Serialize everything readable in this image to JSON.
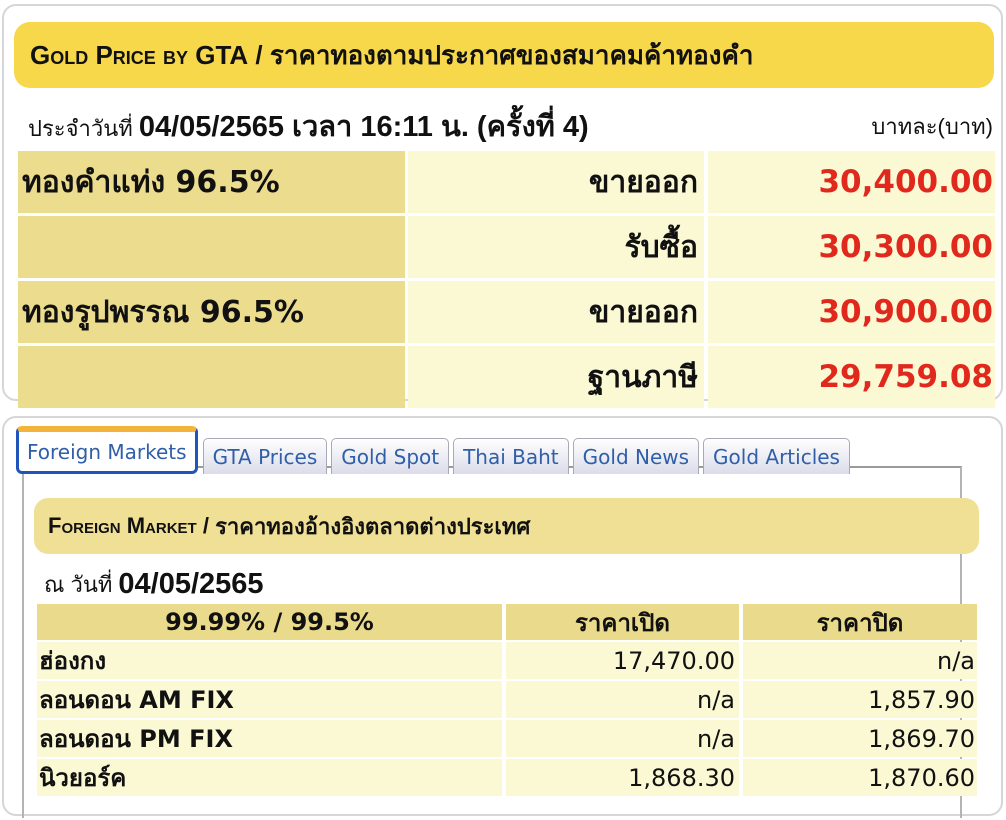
{
  "gta": {
    "header_en": "Gold Price by GTA",
    "header_sep": " / ",
    "header_th": "ราคาทองตามประกาศของสมาคมค้าทองคำ",
    "date_prefix": "ประจำวันที่ ",
    "date_value": "04/05/2565 เวลา 16:11 น. (ครั้งที่ 4)",
    "unit": "บาทละ(บาท)",
    "rows": [
      {
        "product": "ทองคำแท่ง 96.5%",
        "type": "ขายออก",
        "price": "30,400.00"
      },
      {
        "product": "",
        "type": "รับซื้อ",
        "price": "30,300.00"
      },
      {
        "product": "ทองรูปพรรณ 96.5%",
        "type": "ขายออก",
        "price": "30,900.00"
      },
      {
        "product": "",
        "type": "ฐานภาษี",
        "price": "29,759.08"
      }
    ],
    "price_color": "#e0281c"
  },
  "tabs": [
    {
      "label": "Foreign Markets",
      "active": true
    },
    {
      "label": "GTA Prices",
      "active": false
    },
    {
      "label": "Gold Spot",
      "active": false
    },
    {
      "label": "Thai Baht",
      "active": false
    },
    {
      "label": "Gold News",
      "active": false
    },
    {
      "label": "Gold Articles",
      "active": false
    }
  ],
  "foreign": {
    "header_en": "Foreign Market",
    "header_sep": " / ",
    "header_th": "ราคาทองอ้างอิงตลาดต่างประเทศ",
    "date_prefix": "ณ วันที่",
    "date_value": "04/05/2565",
    "columns": [
      "99.99% / 99.5%",
      "ราคาเปิด",
      "ราคาปิด"
    ],
    "rows": [
      {
        "market": "ฮ่องกง",
        "open": "17,470.00",
        "close": "n/a"
      },
      {
        "market": "ลอนดอน AM FIX",
        "open": "n/a",
        "close": "1,857.90"
      },
      {
        "market": "ลอนดอน PM FIX",
        "open": "n/a",
        "close": "1,869.70"
      },
      {
        "market": "นิวยอร์ค",
        "open": "1,868.30",
        "close": "1,870.60"
      }
    ]
  }
}
